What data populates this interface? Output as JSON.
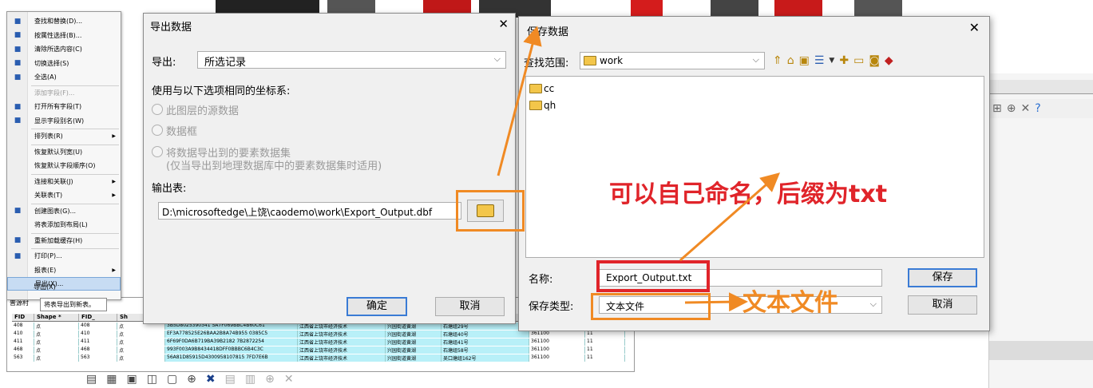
{
  "context_menu": {
    "items": [
      {
        "icon": "binoculars-icon",
        "label": "查找和替换(D)..."
      },
      {
        "icon": "select-attr-icon",
        "label": "按属性选择(B)..."
      },
      {
        "icon": "clear-select-icon",
        "label": "清除所选内容(C)"
      },
      {
        "icon": "switch-select-icon",
        "label": "切换选择(S)"
      },
      {
        "icon": "select-all-icon",
        "label": "全选(A)"
      },
      {
        "icon": "",
        "label": "添加字段(F)...",
        "disabled": true
      },
      {
        "icon": "fields-icon",
        "label": "打开所有字段(T)"
      },
      {
        "icon": "check-icon",
        "label": "显示字段别名(W)"
      },
      {
        "icon": "",
        "label": "排列表(R)",
        "submenu": true
      },
      {
        "icon": "",
        "label": "恢复默认列宽(U)"
      },
      {
        "icon": "",
        "label": "恢复默认字段顺序(O)"
      },
      {
        "icon": "",
        "label": "连接和关联(J)",
        "submenu": true
      },
      {
        "icon": "",
        "label": "关联表(T)",
        "submenu": true
      },
      {
        "icon": "chart-icon",
        "label": "创建图表(G)..."
      },
      {
        "icon": "",
        "label": "将表添加到布局(L)"
      },
      {
        "icon": "reload-icon",
        "label": "重新加载缓存(H)"
      },
      {
        "icon": "print-icon",
        "label": "打印(P)..."
      },
      {
        "icon": "",
        "label": "报表(E)",
        "submenu": true
      },
      {
        "icon": "",
        "label": "导出(X)...",
        "selected": true
      }
    ],
    "tooltip_item": "导出(X)",
    "tooltip": "将表导出到新表。"
  },
  "table": {
    "tab_label": "普源村",
    "columns": [
      "FID",
      "Shape *",
      "FID_",
      "Sh",
      "",
      "",
      "",
      "",
      ""
    ],
    "rows": [
      [
        "408",
        "点",
        "408",
        "点",
        "3B5D8025390341 5A7F069BBC4B60C61",
        "江西省上饶市经济技术",
        "兴园街道黄湖",
        "石塘组29号",
        "361100",
        "11"
      ],
      [
        "410",
        "点",
        "410",
        "点",
        "EF3A778525E26BAA2B8A74B955 0385C5",
        "江西省上饶市经济技术",
        "兴园街道黄湖",
        "石塘组40号",
        "361100",
        "11"
      ],
      [
        "411",
        "点",
        "411",
        "点",
        "6F69F0DA6B719BA39B2182 7B2872254",
        "江西省上饶市经济技术",
        "兴园街道黄湖",
        "石塘组41号",
        "361100",
        "11"
      ],
      [
        "468",
        "点",
        "468",
        "点",
        "993F003A9B8434418DFF0BBBC6B4C3C",
        "江西省上饶市经济技术",
        "兴园街道黄湖",
        "石塘组58号",
        "361100",
        "11"
      ],
      [
        "563",
        "点",
        "563",
        "点",
        "56A81D85915D4300958107815 7FD7E6B",
        "江西省上饶市经济技术",
        "兴园街道黄湖",
        "吴口塘组162号",
        "361100",
        "11"
      ]
    ]
  },
  "export_dialog": {
    "title": "导出数据",
    "export_label": "导出:",
    "export_value": "所选记录",
    "coord_label": "使用与以下选项相同的坐标系:",
    "radio1": "此图层的源数据",
    "radio2": "数据框",
    "radio3": "将数据导出到的要素数据集",
    "radio3_note": "(仅当导出到地理数据库中的要素数据集时适用)",
    "output_label": "输出表:",
    "output_path": "D:\\microsoftedge\\上饶\\caodemo\\work\\Export_Output.dbf",
    "ok": "确定",
    "cancel": "取消"
  },
  "save_dialog": {
    "title": "保存数据",
    "lookin_label": "查找范围:",
    "lookin_value": "work",
    "folders": [
      "cc",
      "qh"
    ],
    "name_label": "名称:",
    "name_value": "Export_Output.txt",
    "type_label": "保存类型:",
    "type_value": "文本文件",
    "save": "保存",
    "cancel": "取消"
  },
  "annotations": {
    "note1": "可以自己命名，后缀为txt",
    "note2": "文本文件",
    "red": "#e0242a",
    "orange": "#f08a24"
  }
}
